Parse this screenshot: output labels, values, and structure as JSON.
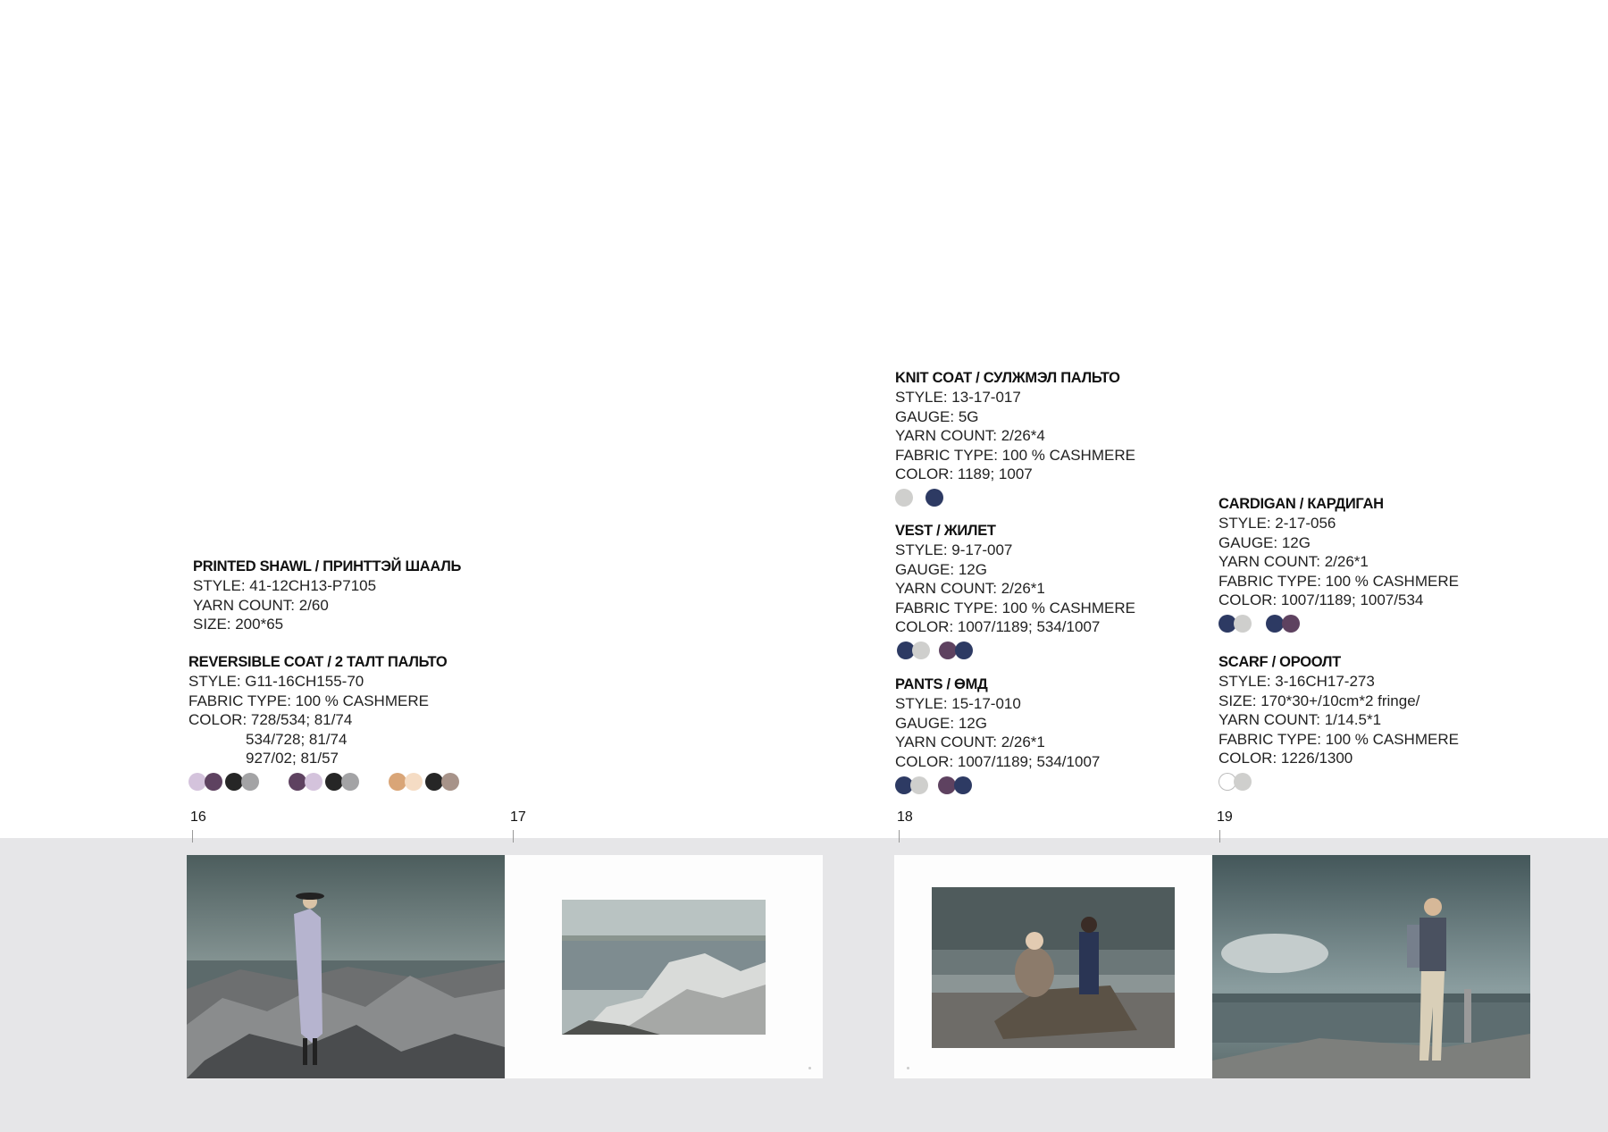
{
  "products": {
    "shawl": {
      "title": "PRINTED SHAWL / ПРИНТТЭЙ ШААЛЬ",
      "lines": [
        "STYLE: 41-12CH13-P7105",
        "YARN COUNT: 2/60",
        "SIZE: 200*65"
      ]
    },
    "coat": {
      "title": "REVERSIBLE COAT / 2 ТАЛТ ПАЛЬТО",
      "lines": [
        "STYLE: G11-16CH155-70",
        "FABRIC TYPE: 100 % CASHMERE",
        "COLOR: 728/534; 81/74"
      ],
      "indent_lines": [
        "534/728; 81/74",
        "927/02; 81/57"
      ],
      "swatches": [
        "#d4c3dc",
        "#5e4260",
        "#262626",
        "#a3a3a5",
        "#5e4260",
        "#d4c3dc",
        "#262626",
        "#a3a3a5",
        "#d9a577",
        "#f5dcc4",
        "#262626",
        "#a79389"
      ]
    },
    "knit_coat": {
      "title": "KNIT COAT / СУЛЖМЭЛ ПАЛЬТО",
      "lines": [
        "STYLE: 13-17-017",
        "GAUGE: 5G",
        "YARN COUNT: 2/26*4",
        "FABRIC TYPE: 100 % CASHMERE",
        "COLOR: 1189; 1007"
      ],
      "swatches": [
        "#cfcfcd",
        "#2d3a63"
      ]
    },
    "vest": {
      "title": "VEST / ЖИЛЕТ",
      "lines": [
        "STYLE: 9-17-007",
        "GAUGE: 12G",
        "YARN COUNT: 2/26*1",
        "FABRIC TYPE: 100 % CASHMERE",
        "COLOR: 1007/1189; 534/1007"
      ],
      "swatches": [
        "#2d3a63",
        "#cfcfcd",
        "#5e4260",
        "#2d3a63"
      ]
    },
    "pants": {
      "title": "PANTS / ӨМД",
      "lines": [
        "STYLE: 15-17-010",
        "GAUGE: 12G",
        "YARN COUNT: 2/26*1",
        "COLOR: 1007/1189; 534/1007"
      ],
      "swatches": [
        "#2d3a63",
        "#cfcfcd",
        "#5e4260",
        "#2d3a63"
      ]
    },
    "cardigan": {
      "title": "CARDIGAN / КАРДИГАН",
      "lines": [
        "STYLE: 2-17-056",
        "GAUGE: 12G",
        "YARN COUNT: 2/26*1",
        "FABRIC TYPE: 100 % CASHMERE",
        "COLOR: 1007/1189; 1007/534"
      ],
      "swatches": [
        "#2d3a63",
        "#cfcfcd",
        "#2d3a63",
        "#5e4260"
      ]
    },
    "scarf": {
      "title": "SCARF / ОРООЛТ",
      "lines": [
        "STYLE: 3-16CH17-273",
        "SIZE: 170*30+/10cm*2 fringe/",
        "YARN COUNT: 1/14.5*1",
        "FABRIC TYPE: 100 % CASHMERE",
        "COLOR: 1226/1300"
      ],
      "swatches": [
        "#ffffff",
        "#cfcfcd"
      ]
    }
  },
  "pages": [
    "16",
    "17",
    "18",
    "19"
  ]
}
